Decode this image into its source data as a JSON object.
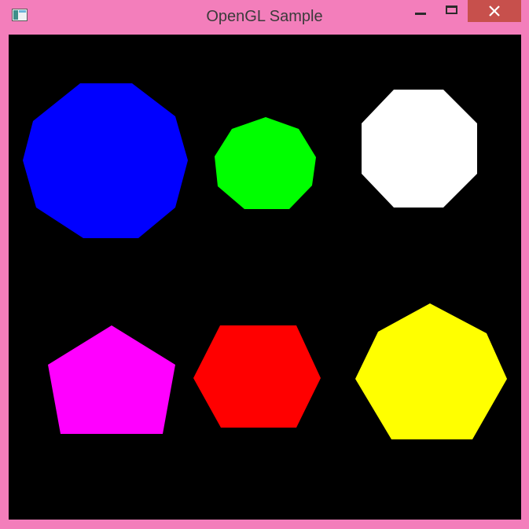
{
  "window": {
    "title": "OpenGL Sample",
    "frame_color": "#f37ebb",
    "close_button_color": "#c7504c"
  },
  "icons": {
    "app": "opengl-app-icon",
    "minimize": "minimize-icon",
    "maximize": "maximize-icon",
    "close": "close-icon"
  },
  "canvas": {
    "background": "#000000",
    "shapes": [
      {
        "name": "decagon",
        "sides": 10,
        "color": "#0000ff"
      },
      {
        "name": "nonagon",
        "sides": 9,
        "color": "#00ff00"
      },
      {
        "name": "octagon",
        "sides": 8,
        "color": "#ffffff"
      },
      {
        "name": "pentagon",
        "sides": 5,
        "color": "#ff00ff"
      },
      {
        "name": "hexagon",
        "sides": 6,
        "color": "#ff0000"
      },
      {
        "name": "heptagon",
        "sides": 7,
        "color": "#ffff00"
      }
    ]
  }
}
